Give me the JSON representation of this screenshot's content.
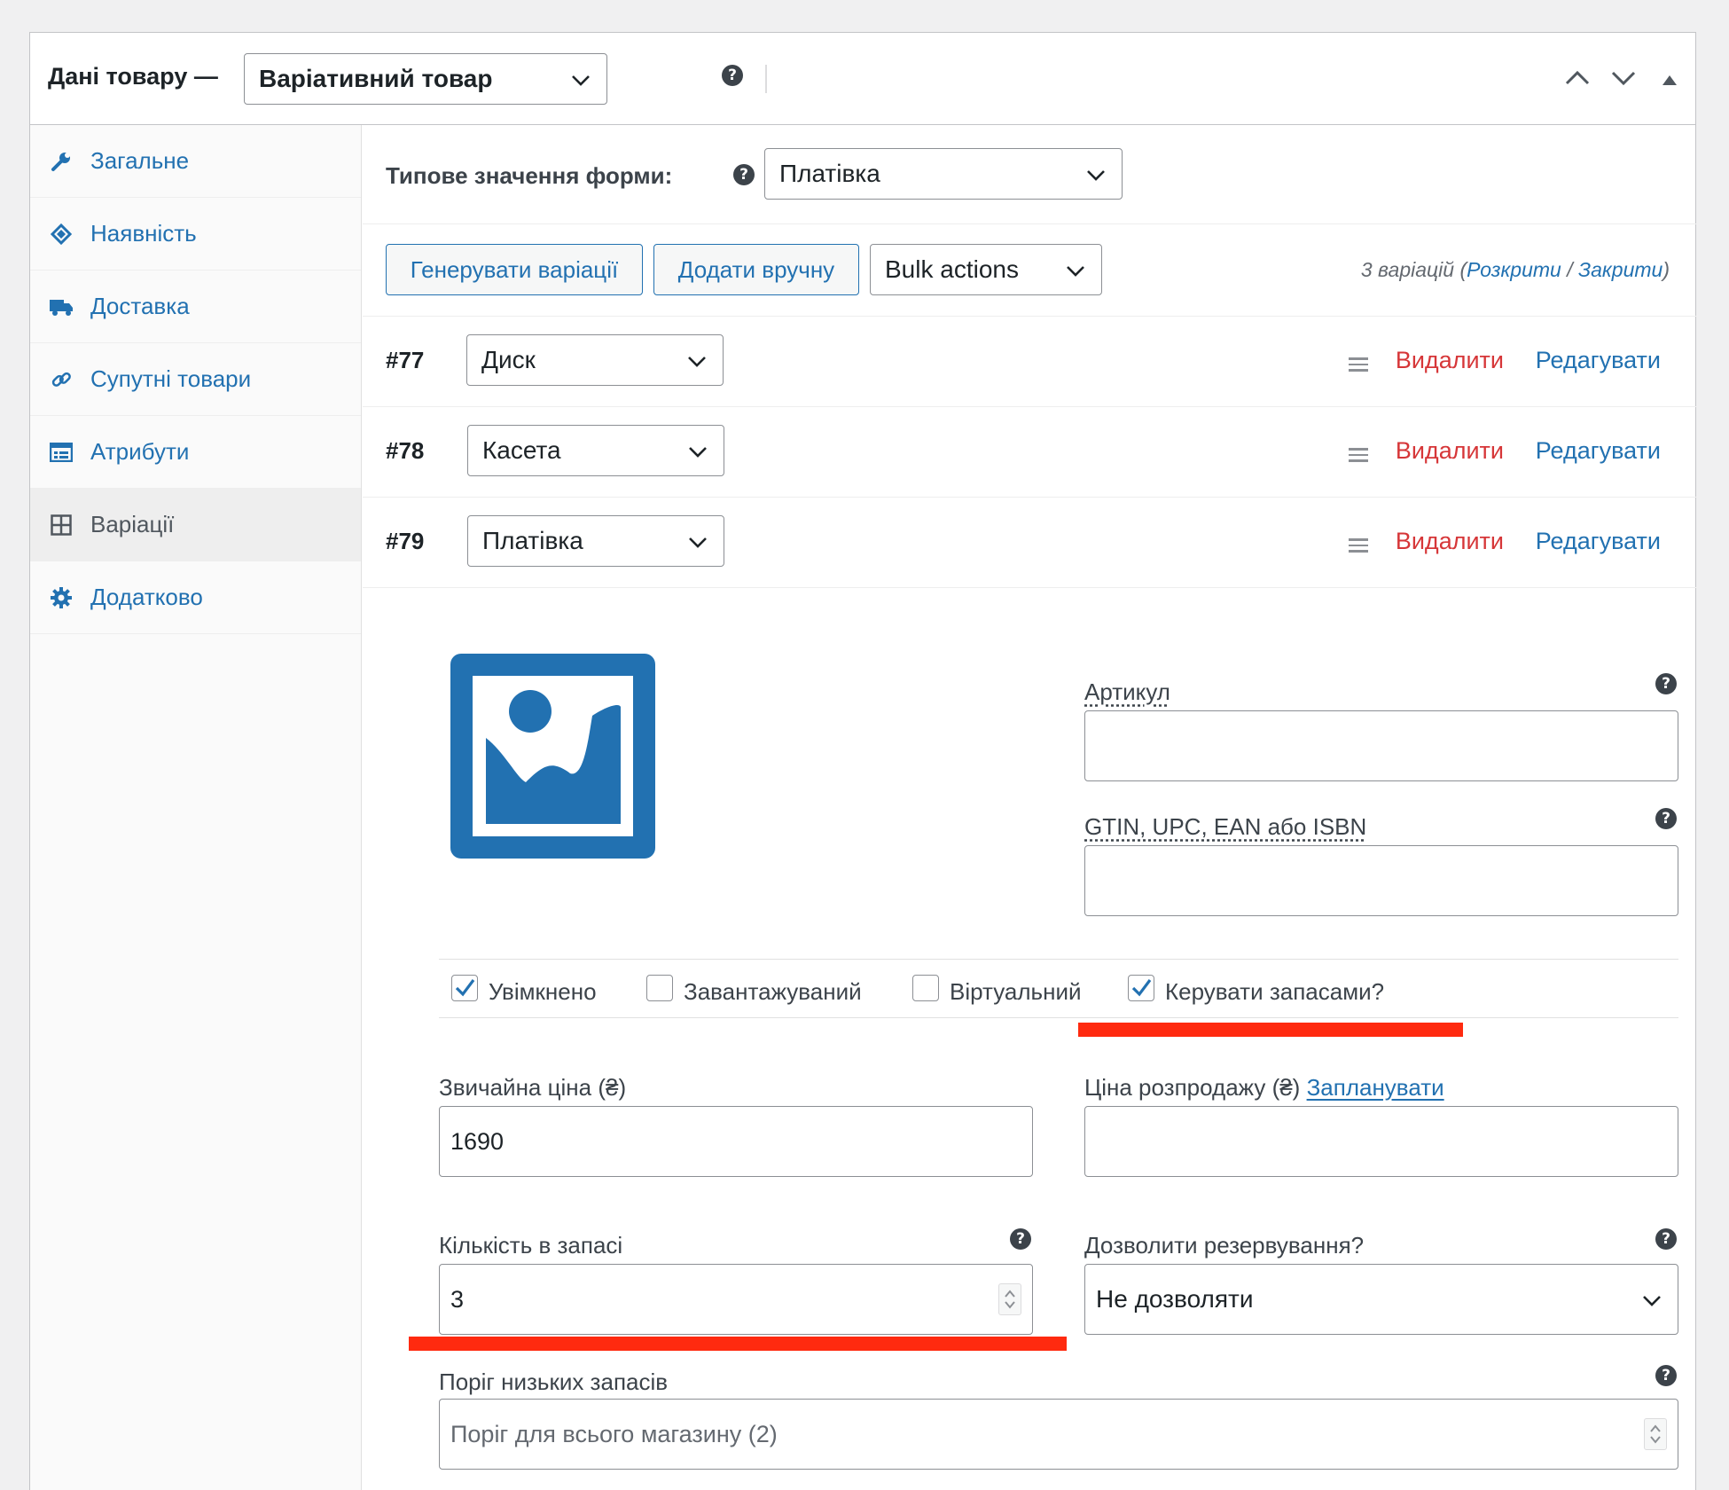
{
  "header": {
    "title": "Дані товару —",
    "product_type": "Варіативний товар",
    "help": "?"
  },
  "sidebar": {
    "items": [
      {
        "label": "Загальне",
        "icon": "wrench-icon"
      },
      {
        "label": "Наявність",
        "icon": "tag-icon"
      },
      {
        "label": "Доставка",
        "icon": "truck-icon"
      },
      {
        "label": "Супутні товари",
        "icon": "link-icon"
      },
      {
        "label": "Атрибути",
        "icon": "list-icon"
      },
      {
        "label": "Варіації",
        "icon": "grid-icon",
        "active": true
      },
      {
        "label": "Додатково",
        "icon": "gear-icon"
      }
    ]
  },
  "defaults": {
    "label": "Типове значення форми:",
    "value": "Платівка"
  },
  "toolbar": {
    "generate": "Генерувати варіації",
    "add_manual": "Додати вручну",
    "bulk": "Bulk actions",
    "count_text": "3 варіацій (",
    "expand": "Розкрити",
    "sep": " / ",
    "close": "Закрити",
    "close_paren": ")"
  },
  "variations": [
    {
      "id": "#77",
      "value": "Диск",
      "delete": "Видалити",
      "edit": "Редагувати"
    },
    {
      "id": "#78",
      "value": "Касета",
      "delete": "Видалити",
      "edit": "Редагувати"
    },
    {
      "id": "#79",
      "value": "Платівка",
      "delete": "Видалити",
      "edit": "Редагувати"
    }
  ],
  "detail": {
    "sku_label": "Артикул",
    "sku_value": "",
    "gtin_label": "GTIN, UPC, EAN або ISBN",
    "gtin_value": "",
    "checkboxes": [
      {
        "label": "Увімкнено",
        "checked": true
      },
      {
        "label": "Завантажуваний",
        "checked": false
      },
      {
        "label": "Віртуальний",
        "checked": false
      },
      {
        "label": "Керувати запасами?",
        "checked": true
      }
    ],
    "regular_price_label": "Звичайна ціна (₴)",
    "regular_price_value": "1690",
    "sale_price_label": "Ціна розпродажу (₴)",
    "schedule": "Запланувати",
    "sale_price_value": "",
    "stock_qty_label": "Кількість в запасі",
    "stock_qty_value": "3",
    "backorders_label": "Дозволити резервування?",
    "backorders_value": "Не дозволяти",
    "low_stock_label": "Поріг низьких запасів",
    "low_stock_placeholder": "Поріг для всього магазину (2)"
  },
  "colors": {
    "accent": "#2271b1",
    "danger": "#d63638",
    "highlight": "#ff2a0f"
  }
}
